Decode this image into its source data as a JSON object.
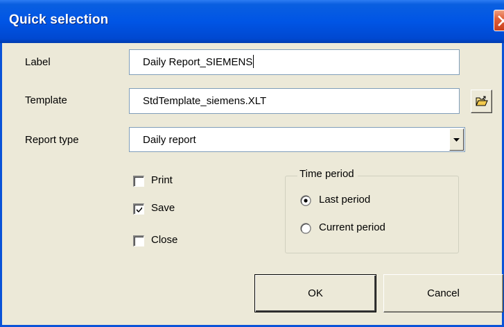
{
  "window": {
    "title": "Quick selection"
  },
  "form": {
    "label_label": "Label",
    "label_value": "Daily Report_SIEMENS",
    "template_label": "Template",
    "template_value": "StdTemplate_siemens.XLT",
    "report_type_label": "Report type",
    "report_type_value": "Daily report"
  },
  "options": {
    "print_label": "Print",
    "print_checked": false,
    "save_label": "Save",
    "save_checked": true,
    "close_label": "Close",
    "close_checked": false
  },
  "time_period": {
    "legend": "Time period",
    "last_period_label": "Last period",
    "current_period_label": "Current period",
    "selected": "Last period"
  },
  "buttons": {
    "ok_label": "OK",
    "cancel_label": "Cancel"
  },
  "icons": {
    "close": "close-icon",
    "browse": "open-folder-icon",
    "dropdown": "chevron-down-icon"
  },
  "colors": {
    "title_bar": "#0055e5",
    "close_button": "#e0603a",
    "dialog_background": "#ece9d8"
  }
}
